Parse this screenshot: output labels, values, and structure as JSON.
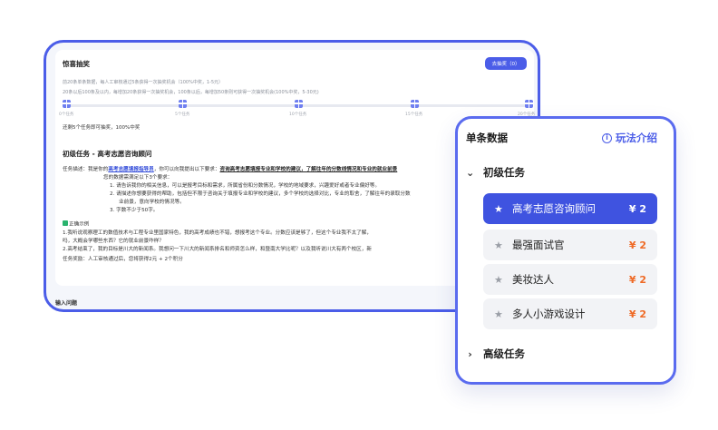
{
  "lottery": {
    "title": "惊喜抽奖",
    "button_label": "去抽奖（0）",
    "rule_line1": "前20条单条数据，每人工审核通过5条获得一次抽奖机会（100%中奖，1-5元）",
    "rule_line2": "20条以后100条及以内，每增加20条获得一次抽奖机会，100条以后，每增加50条则可获得一次抽奖机会(100%中奖，5-30元)",
    "milestones": [
      "0个任务",
      "5个任务",
      "10个任务",
      "15个任务",
      "20个任务"
    ],
    "progress": 0,
    "remaining_text": "还剩5个任务即可抽奖，100%中奖"
  },
  "task": {
    "title": "初级任务 - 高考志愿咨询顾问",
    "desc_label": "任务描述：",
    "desc_part1": "我是你的",
    "desc_link": "高考志愿填报指导员",
    "desc_part2": "，你可以向我提出以下要求：",
    "desc_underlined": "咨询高考志愿填报专业和学校的建议，了解往年的分数线情况和专业的就业前景",
    "desc_line2": "您的数据需满足以下3个要求：",
    "req1": "1. 请告诉我你的相关信息，可以是报考目标和需求，所属省份和分数情况，学校的地域要求，兴趣爱好或者专业偏好等。",
    "req2a": "2. 请描述你想要获得的帮助，包括但不限于咨询关于填报专业和学校的建议，多个学校的选择对比，专业的取舍，了解往年的录取分数",
    "req2b": "业前景，意向学校的情况等。",
    "req3": "3. 字数不少于50字。",
    "example_title": "正确示例",
    "example1a": "1.我听说观察理工的数值技术与工程专业里国家特色，我的高考成绩也不错，想报考这个专业。分数应该是够了，但这个专业我不太了解，",
    "example1b": "吗，大概会学哪些东西？它的就业前景咋样？",
    "example2": "2.高考结束了，我的目标是川大的新闻系。我想问一下川大的新闻系排名和师资怎么样，和暨南大学比呢？以及我听说川大有两个校区，新",
    "reward": "任务奖励：人工审核通过后，您将获得2元 + 2个积分"
  },
  "input_section_label": "输入问题",
  "panel": {
    "title": "单条数据",
    "intro_label": "玩法介绍",
    "groups": [
      {
        "label": "初级任务",
        "expanded": true,
        "items": [
          {
            "name": "高考志愿咨询顾问",
            "price": "¥ 2",
            "active": true
          },
          {
            "name": "最强面试官",
            "price": "¥ 2",
            "active": false
          },
          {
            "name": "美妆达人",
            "price": "¥ 2",
            "active": false
          },
          {
            "name": "多人小游戏设计",
            "price": "¥ 2",
            "active": false
          }
        ]
      },
      {
        "label": "高级任务",
        "expanded": false
      }
    ]
  },
  "colors": {
    "accent": "#4b5de8",
    "price": "#ef6a26",
    "success": "#2ab36e"
  },
  "icons": {
    "info": "info-icon",
    "star": "star-icon",
    "gift": "gift-icon",
    "expand": "chevron-down-icon",
    "collapse": "chevron-right-icon",
    "check": "check-icon"
  }
}
